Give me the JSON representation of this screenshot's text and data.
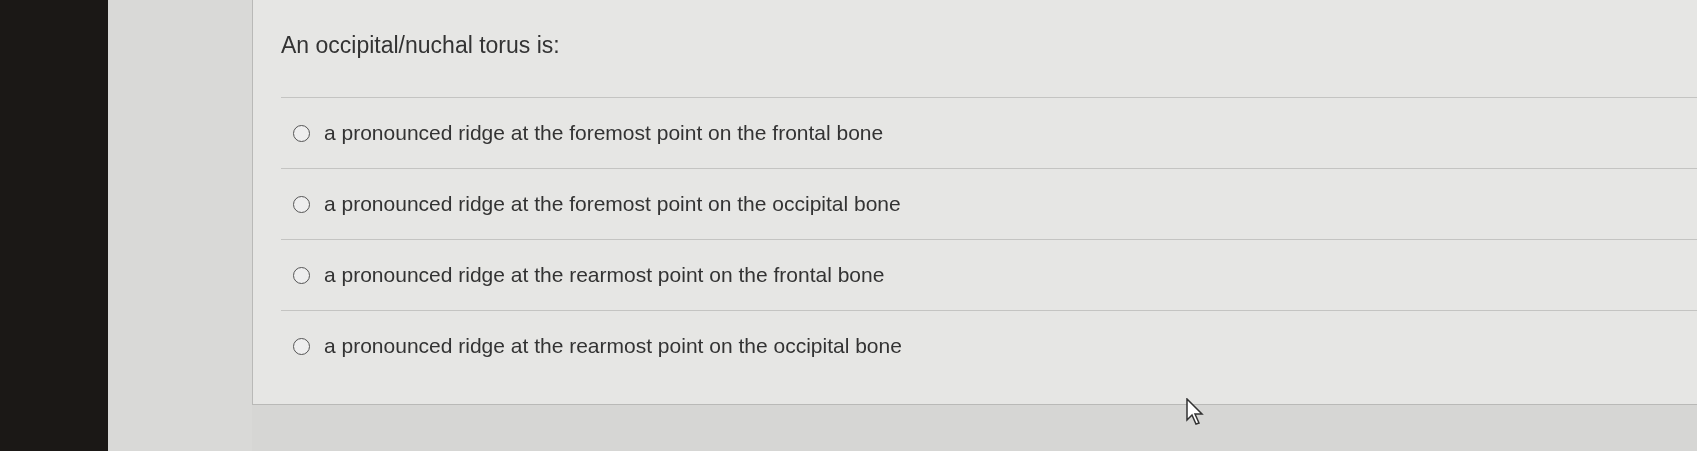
{
  "question": {
    "text": "An occipital/nuchal torus is:",
    "options": [
      {
        "label": "a pronounced ridge at the foremost point on the frontal bone",
        "selected": false
      },
      {
        "label": "a pronounced ridge at the foremost point on the occipital bone",
        "selected": false
      },
      {
        "label": "a pronounced ridge at the rearmost point on the frontal bone",
        "selected": false
      },
      {
        "label": "a pronounced ridge at the rearmost point on the occipital bone",
        "selected": false
      }
    ]
  }
}
